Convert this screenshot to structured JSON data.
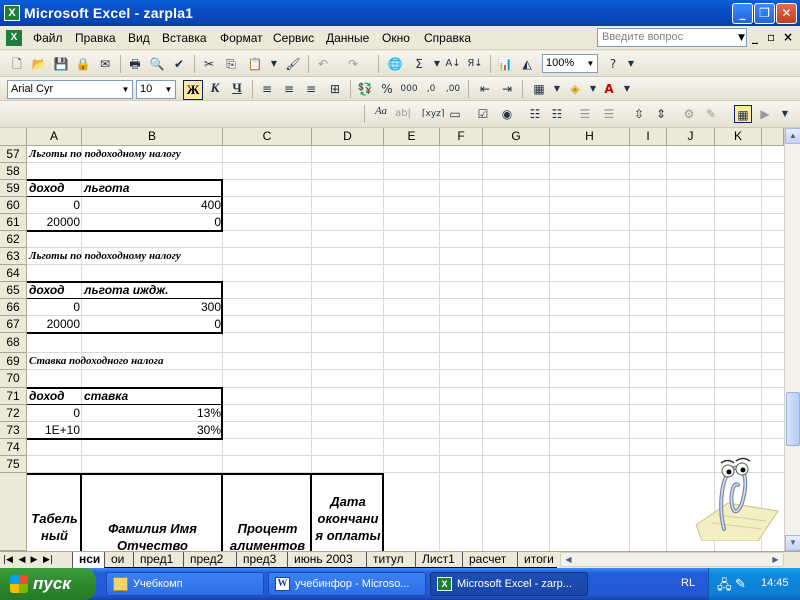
{
  "window": {
    "title": "Microsoft Excel - zarpla1",
    "minimize": "_",
    "restore": "❐",
    "close": "✕"
  },
  "menu": {
    "items": [
      "Файл",
      "Правка",
      "Вид",
      "Вставка",
      "Формат",
      "Сервис",
      "Данные",
      "Окно",
      "Справка"
    ],
    "help_placeholder": "Введите вопрос",
    "doc_min": "_",
    "doc_restore": "▫",
    "doc_close": "×"
  },
  "toolbar": {
    "zoom": "100%",
    "font_name": "Arial Cyr",
    "font_size": "10",
    "bold": "Ж",
    "italic": "К",
    "underline": "Ч"
  },
  "sheet": {
    "columns": [
      "A",
      "B",
      "C",
      "D",
      "E",
      "F",
      "G",
      "H",
      "I",
      "J",
      "K"
    ],
    "rows": [
      "57",
      "58",
      "59",
      "60",
      "61",
      "62",
      "63",
      "64",
      "65",
      "66",
      "67",
      "68",
      "69",
      "70",
      "71",
      "72",
      "73",
      "74",
      "75"
    ],
    "block1": {
      "title": "Льготы по подоходному налогу",
      "h1": "доход",
      "h2": "льгота",
      "r1a": "0",
      "r1b": "400",
      "r2a": "20000",
      "r2b": "0"
    },
    "block2": {
      "title": "Льготы по подоходному налогу",
      "h1": "доход",
      "h2": "льгота иждж.",
      "r1a": "0",
      "r1b": "300",
      "r2a": "20000",
      "r2b": "0"
    },
    "block3": {
      "title": "Ставка подоходного налога",
      "h1": "доход",
      "h2": "ставка",
      "r1a": "0",
      "r1b": "13%",
      "r2a": "1E+10",
      "r2b": "30%"
    },
    "table_header": {
      "a": "Табель ный",
      "b": "Фамилия Имя Отчество",
      "c": "Процент алиментов",
      "d": "Дата окончани я оплаты"
    }
  },
  "tabs": [
    "нси",
    "ои",
    "пред1",
    "пред2",
    "пред3",
    "июнь 2003",
    "титул",
    "Лист1",
    "расчет",
    "итоги"
  ],
  "active_tab": "нси",
  "taskbar": {
    "start": "пуск",
    "tasks": [
      "Учебкомп",
      "учебинфор - Microso...",
      "Microsoft Excel - zarp..."
    ],
    "lang": "RL",
    "time": "14:45"
  }
}
